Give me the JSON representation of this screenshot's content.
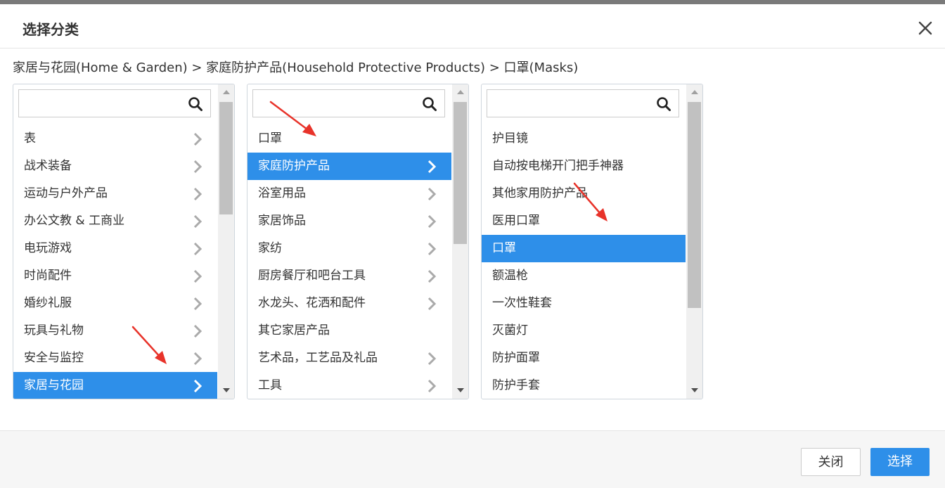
{
  "dialog": {
    "title": "选择分类",
    "breadcrumb": "家居与花园(Home & Garden) > 家庭防护产品(Household Protective Products) > 口罩(Masks)"
  },
  "colors": {
    "accent": "#2e8fe9",
    "arrow": "#e8332a"
  },
  "columns": [
    {
      "search_placeholder": "",
      "items": [
        {
          "label": "表",
          "has_children": true,
          "selected": false
        },
        {
          "label": "战术装备",
          "has_children": true,
          "selected": false
        },
        {
          "label": "运动与户外产品",
          "has_children": true,
          "selected": false
        },
        {
          "label": "办公文教 & 工商业",
          "has_children": true,
          "selected": false
        },
        {
          "label": "电玩游戏",
          "has_children": true,
          "selected": false
        },
        {
          "label": "时尚配件",
          "has_children": true,
          "selected": false
        },
        {
          "label": "婚纱礼服",
          "has_children": true,
          "selected": false
        },
        {
          "label": "玩具与礼物",
          "has_children": true,
          "selected": false
        },
        {
          "label": "安全与监控",
          "has_children": true,
          "selected": false
        },
        {
          "label": "家居与花园",
          "has_children": true,
          "selected": true
        }
      ]
    },
    {
      "search_placeholder": "",
      "items": [
        {
          "label": "口罩",
          "has_children": false,
          "selected": false
        },
        {
          "label": "家庭防护产品",
          "has_children": true,
          "selected": true
        },
        {
          "label": "浴室用品",
          "has_children": true,
          "selected": false
        },
        {
          "label": "家居饰品",
          "has_children": true,
          "selected": false
        },
        {
          "label": "家纺",
          "has_children": true,
          "selected": false
        },
        {
          "label": "厨房餐厅和吧台工具",
          "has_children": true,
          "selected": false
        },
        {
          "label": "水龙头、花洒和配件",
          "has_children": true,
          "selected": false
        },
        {
          "label": "其它家居产品",
          "has_children": false,
          "selected": false
        },
        {
          "label": "艺术品，工艺品及礼品",
          "has_children": true,
          "selected": false
        },
        {
          "label": "工具",
          "has_children": true,
          "selected": false
        }
      ]
    },
    {
      "search_placeholder": "",
      "items": [
        {
          "label": "护目镜",
          "has_children": false,
          "selected": false
        },
        {
          "label": "自动按电梯开门把手神器",
          "has_children": false,
          "selected": false
        },
        {
          "label": "其他家用防护产品",
          "has_children": false,
          "selected": false
        },
        {
          "label": "医用口罩",
          "has_children": false,
          "selected": false
        },
        {
          "label": "口罩",
          "has_children": false,
          "selected": true
        },
        {
          "label": "额温枪",
          "has_children": false,
          "selected": false
        },
        {
          "label": "一次性鞋套",
          "has_children": false,
          "selected": false
        },
        {
          "label": "灭菌灯",
          "has_children": false,
          "selected": false
        },
        {
          "label": "防护面罩",
          "has_children": false,
          "selected": false
        },
        {
          "label": "防护手套",
          "has_children": false,
          "selected": false
        }
      ]
    }
  ],
  "footer": {
    "close_label": "关闭",
    "select_label": "选择"
  }
}
